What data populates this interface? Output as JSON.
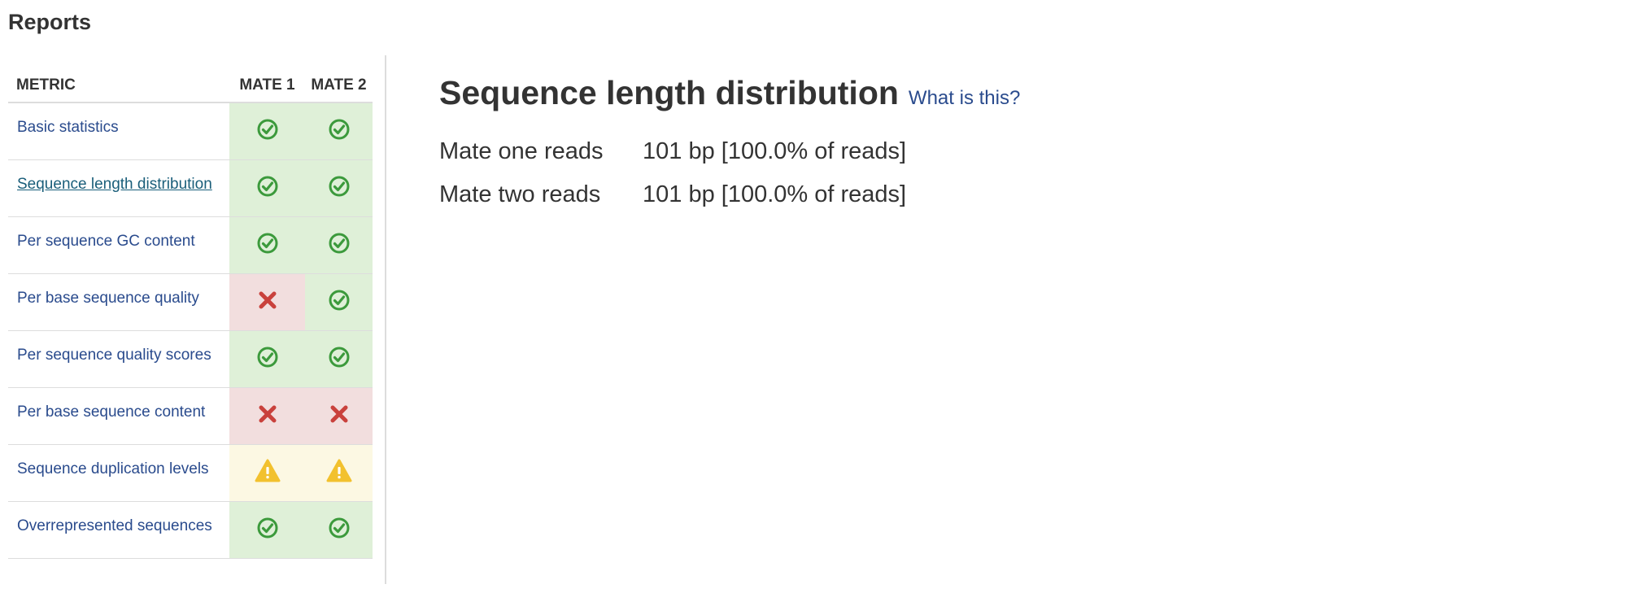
{
  "page": {
    "title": "Reports"
  },
  "metrics_table": {
    "headers": {
      "metric": "METRIC",
      "mate1": "MATE 1",
      "mate2": "MATE 2"
    },
    "rows": [
      {
        "label": "Basic statistics",
        "mate1": "pass",
        "mate2": "pass",
        "active": false
      },
      {
        "label": "Sequence length distribution",
        "mate1": "pass",
        "mate2": "pass",
        "active": true
      },
      {
        "label": "Per sequence GC content",
        "mate1": "pass",
        "mate2": "pass",
        "active": false
      },
      {
        "label": "Per base sequence quality",
        "mate1": "fail",
        "mate2": "pass",
        "active": false
      },
      {
        "label": "Per sequence quality scores",
        "mate1": "pass",
        "mate2": "pass",
        "active": false
      },
      {
        "label": "Per base sequence content",
        "mate1": "fail",
        "mate2": "fail",
        "active": false
      },
      {
        "label": "Sequence duplication levels",
        "mate1": "warn",
        "mate2": "warn",
        "active": false
      },
      {
        "label": "Overrepresented sequences",
        "mate1": "pass",
        "mate2": "pass",
        "active": false
      }
    ]
  },
  "status_icons": {
    "pass": "check-circle-icon",
    "fail": "x-mark-icon",
    "warn": "warning-triangle-icon"
  },
  "colors": {
    "link": "#2a4b8d",
    "active_link": "#1a5e7a",
    "pass_bg": "#dff0d8",
    "fail_bg": "#f2dede",
    "warn_bg": "#fcf8e3",
    "pass_icon": "#3c9a3c",
    "fail_icon": "#c9413c",
    "warn_icon": "#f2c12e"
  },
  "detail": {
    "title": "Sequence length distribution",
    "help_link": "What is this?",
    "reads": [
      {
        "label": "Mate one reads",
        "value": "101 bp [100.0% of reads]"
      },
      {
        "label": "Mate two reads",
        "value": "101 bp [100.0% of reads]"
      }
    ]
  }
}
